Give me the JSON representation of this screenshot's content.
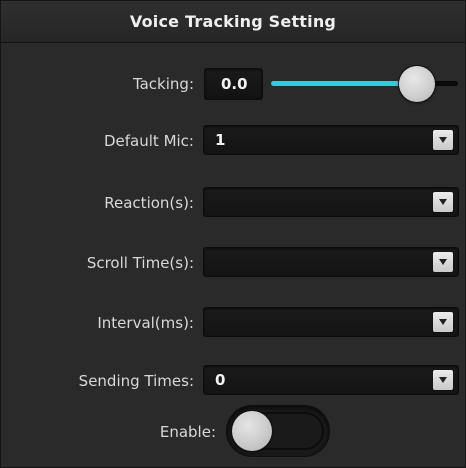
{
  "dialog": {
    "title": "Voice Tracking Setting"
  },
  "tacking": {
    "label": "Tacking:",
    "value": "0.0",
    "slider_fraction": 0.78
  },
  "default_mic": {
    "label": "Default Mic:",
    "value": "1"
  },
  "reaction": {
    "label": "Reaction(s):",
    "value": ""
  },
  "scroll_time": {
    "label": "Scroll Time(s):",
    "value": ""
  },
  "interval": {
    "label": "Interval(ms):",
    "value": ""
  },
  "sending_times": {
    "label": "Sending Times:",
    "value": "0"
  },
  "enable": {
    "label": "Enable:",
    "state": "off"
  },
  "colors": {
    "accent": "#1fd2e6",
    "background": "#2a2a2a",
    "field": "#161616"
  },
  "icons": {
    "dropdown": "chevron-down-icon"
  }
}
